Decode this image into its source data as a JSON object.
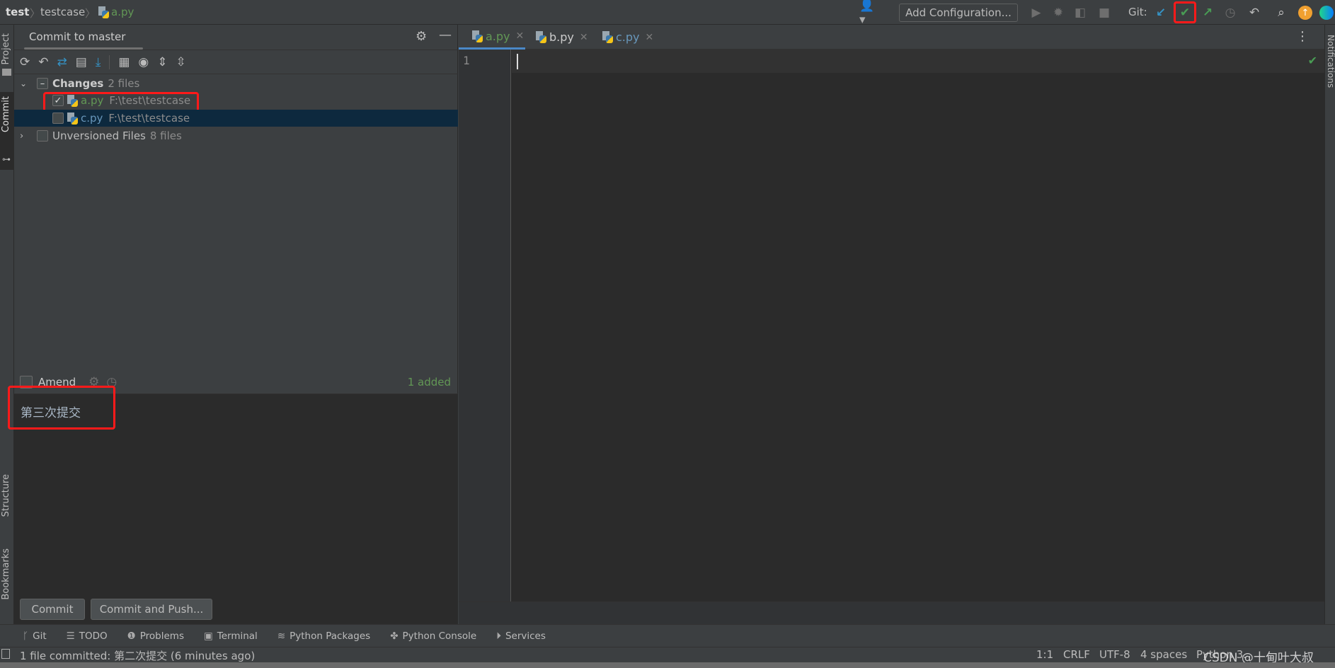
{
  "breadcrumb": {
    "project": "test",
    "folder": "testcase",
    "file": "a.py"
  },
  "toolbar": {
    "add_configuration": "Add Configuration...",
    "git_label": "Git:"
  },
  "left_strip": {
    "project": "Project",
    "commit": "Commit",
    "structure": "Structure",
    "bookmarks": "Bookmarks"
  },
  "right_strip": {
    "notifications": "Notifications"
  },
  "commit_panel": {
    "title": "Commit to master",
    "changes": {
      "label": "Changes",
      "count": "2 files"
    },
    "files": [
      {
        "name": "a.py",
        "path": "F:\\test\\testcase",
        "checked": true,
        "color": "#629755"
      },
      {
        "name": "c.py",
        "path": "F:\\test\\testcase",
        "checked": false,
        "color": "#6897bb"
      }
    ],
    "unversioned": {
      "label": "Unversioned Files",
      "count": "8 files"
    },
    "amend": "Amend",
    "added": "1 added",
    "message": "第三次提交",
    "commit_button": "Commit",
    "commit_push_button": "Commit and Push..."
  },
  "editor": {
    "tabs": [
      {
        "name": "a.py",
        "active": true
      },
      {
        "name": "b.py",
        "active": false
      },
      {
        "name": "c.py",
        "active": false
      }
    ],
    "line_numbers": [
      "1"
    ]
  },
  "tool_windows": [
    {
      "icon": "git-branch-icon",
      "label": "Git"
    },
    {
      "icon": "list-icon",
      "label": "TODO"
    },
    {
      "icon": "warning-icon",
      "label": "Problems"
    },
    {
      "icon": "terminal-icon",
      "label": "Terminal"
    },
    {
      "icon": "layers-icon",
      "label": "Python Packages"
    },
    {
      "icon": "python-icon",
      "label": "Python Console"
    },
    {
      "icon": "play-circle-icon",
      "label": "Services"
    }
  ],
  "status": {
    "message": "1 file committed: 第二次提交 (6 minutes ago)",
    "position": "1:1",
    "line_ending": "CRLF",
    "encoding": "UTF-8",
    "indent": "4 spaces",
    "interpreter": "Python 3.",
    "watermark": "CSDN @十甸叶大叔"
  },
  "colors": {
    "accent": "#4a88c7",
    "added": "#629755",
    "highlight": "#ff1a1a",
    "selection": "#0d293e"
  }
}
